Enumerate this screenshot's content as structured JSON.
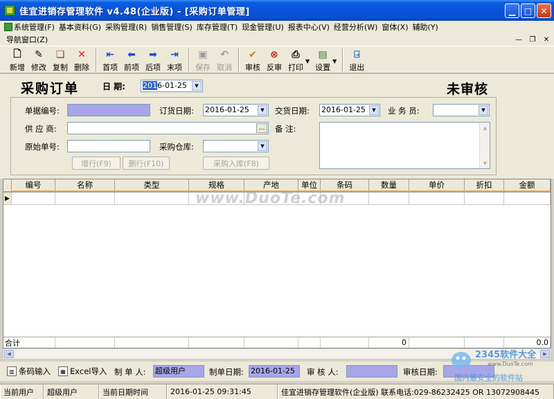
{
  "window": {
    "title": "佳宜进销存管理软件 v4.48(企业版) - [采购订单管理]"
  },
  "menu": {
    "items": [
      {
        "label": "系统管理(F)",
        "icon": "app-icon"
      },
      {
        "label": "基本资料(G)"
      },
      {
        "label": "采购管理(R)"
      },
      {
        "label": "销售管理(S)"
      },
      {
        "label": "库存管理(T)"
      },
      {
        "label": "现金管理(U)"
      },
      {
        "label": "报表中心(V)"
      },
      {
        "label": "经营分析(W)"
      },
      {
        "label": "窗体(X)"
      },
      {
        "label": "辅助(Y)"
      }
    ],
    "nav_window": "导航窗口(Z)"
  },
  "toolbar": {
    "new": "新增",
    "edit": "修改",
    "copy": "复制",
    "delete": "删除",
    "first": "首项",
    "prev": "前项",
    "next": "后项",
    "last": "末项",
    "save": "保存",
    "cancel": "取消",
    "audit": "审核",
    "unaudit": "反审",
    "print": "打印",
    "settings": "设置",
    "exit": "退出"
  },
  "form": {
    "title": "采购订单",
    "date_label": "日 期:",
    "date_sel": "201",
    "date_rest": "6-01-25",
    "status": "未审核",
    "doc_no_label": "单据编号:",
    "doc_no_value": "",
    "order_date_label": "订货日期:",
    "order_date_value": "2016-01-25",
    "delivery_date_label": "交货日期:",
    "delivery_date_value": "2016-01-25",
    "salesman_label": "业 务 员:",
    "salesman_value": "",
    "supplier_label": "供 应 商:",
    "supplier_value": "",
    "remark_label": "备 注:",
    "orig_no_label": "原始单号:",
    "orig_no_value": "",
    "warehouse_label": "采购仓库:",
    "warehouse_value": "",
    "add_row_btn": "增行(F9)",
    "del_row_btn": "删行(F10)",
    "stock_in_btn": "采购入库(F8)"
  },
  "grid": {
    "columns": [
      "编号",
      "名称",
      "类型",
      "规格",
      "产地",
      "单位",
      "条码",
      "数量",
      "单价",
      "折扣",
      "金额"
    ],
    "total_label": "合计",
    "total_qty": "0",
    "total_amount": "0.0"
  },
  "watermark": "www.DuoTe.com",
  "infobar": {
    "barcode_btn": "条码输入",
    "excel_btn": "Excel导入",
    "maker_label": "制 单 人:",
    "maker_value": "超级用户",
    "make_date_label": "制单日期:",
    "make_date_value": "2016-01-25",
    "auditor_label": "审 核 人:",
    "auditor_value": "",
    "audit_date_label": "审核日期:",
    "audit_date_value": ""
  },
  "statusbar": {
    "cur_user_label": "当前用户",
    "cur_user_value": "超级用户",
    "cur_time_label": "当前日期时间",
    "cur_time_value": "2016-01-25 09:31:45",
    "company": "佳宜进销存管理软件(企业版) 联系电话:029-86232425 OR 13072908445"
  },
  "logo": {
    "brand": "2345软件大全",
    "site": "www.DuoTe.com",
    "slogan": "国内最安全的软件站"
  }
}
